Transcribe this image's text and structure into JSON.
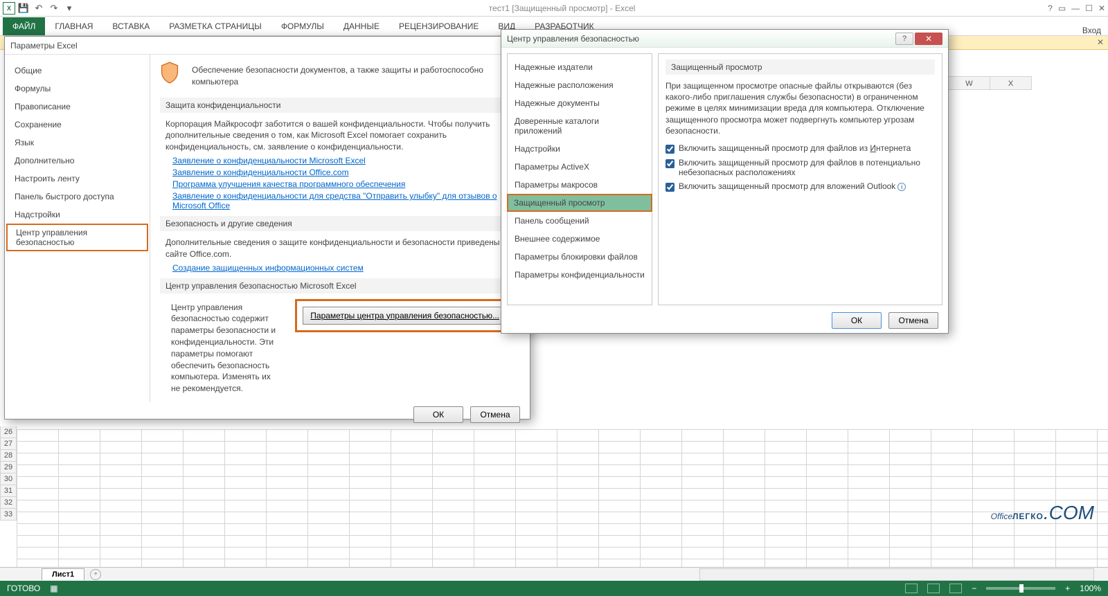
{
  "titlebar": {
    "title": "тест1 [Защищенный просмотр] - Excel",
    "login": "Вход"
  },
  "ribbon": {
    "file": "ФАЙЛ",
    "home": "ГЛАВНАЯ",
    "insert": "ВСТАВКА",
    "layout": "РАЗМЕТКА СТРАНИЦЫ",
    "formulas": "ФОРМУЛЫ",
    "data": "ДАННЫЕ",
    "review": "РЕЦЕНЗИРОВАНИЕ",
    "view": "ВИД",
    "dev": "РАЗРАБОТЧИК"
  },
  "cols": [
    "W",
    "X"
  ],
  "rows": [
    "26",
    "27",
    "28",
    "29",
    "30",
    "31",
    "32",
    "33"
  ],
  "sheet": {
    "tab": "Лист1"
  },
  "status": {
    "ready": "ГОТОВО",
    "zoom": "100%"
  },
  "watermark": {
    "a": "Office",
    "b": "ЛЕГКО",
    "c": ".COM"
  },
  "options": {
    "title": "Параметры Excel",
    "nav": [
      "Общие",
      "Формулы",
      "Правописание",
      "Сохранение",
      "Язык",
      "Дополнительно",
      "Настроить ленту",
      "Панель быстрого доступа",
      "Надстройки",
      "Центр управления безопасностью"
    ],
    "headline": "Обеспечение безопасности документов, а также защиты и работоспособно компьютера",
    "sect1": "Защита конфиденциальности",
    "para1": "Корпорация Майкрософт заботится о вашей конфиденциальности. Чтобы получить дополнительные сведения о том, как Microsoft Excel помогает сохранить конфиденциальность, см. заявление о конфиденциальности.",
    "link1": "Заявление о конфиденциальности Microsoft Excel",
    "link2": "Заявление о конфиденциальности Office.com",
    "link3": "Программа улучшения качества программного обеспечения",
    "link4": "Заявление о конфиденциальности для средства \"Отправить улыбку\" для отзывов о Microsoft Office",
    "sect2": "Безопасность и другие сведения",
    "para2": "Дополнительные сведения о защите конфиденциальности и безопасности приведены на сайте Office.com.",
    "link5": "Создание защищенных информационных систем",
    "sect3": "Центр управления безопасностью Microsoft Excel",
    "para3": "Центр управления безопасностью содержит параметры безопасности и конфиденциальности. Эти параметры помогают обеспечить безопасность компьютера. Изменять их не рекомендуется.",
    "trustBtn": "Параметры центра управления безопасностью...",
    "ok": "ОК",
    "cancel": "Отмена"
  },
  "trust": {
    "title": "Центр управления безопасностью",
    "nav": [
      "Надежные издатели",
      "Надежные расположения",
      "Надежные документы",
      "Доверенные каталоги приложений",
      "Надстройки",
      "Параметры ActiveX",
      "Параметры макросов",
      "Защищенный просмотр",
      "Панель сообщений",
      "Внешнее содержимое",
      "Параметры блокировки файлов",
      "Параметры конфиденциальности"
    ],
    "sect": "Защищенный просмотр",
    "para": "При защищенном просмотре опасные файлы открываются (без какого-либо приглашения службы безопасности) в ограниченном режиме в целях минимизации вреда для компьютера. Отключение защищенного просмотра может подвергнуть компьютер угрозам безопасности.",
    "chk1a": "Включить защищенный просмотр для файлов из ",
    "chk1b": "И",
    "chk1c": "нтернета",
    "chk2": "Включить защищенный просмотр для файлов в потенциально небезопасных расположениях",
    "chk3": "Включить защищенный просмотр для вложений Outlook",
    "ok": "ОК",
    "cancel": "Отмена"
  }
}
